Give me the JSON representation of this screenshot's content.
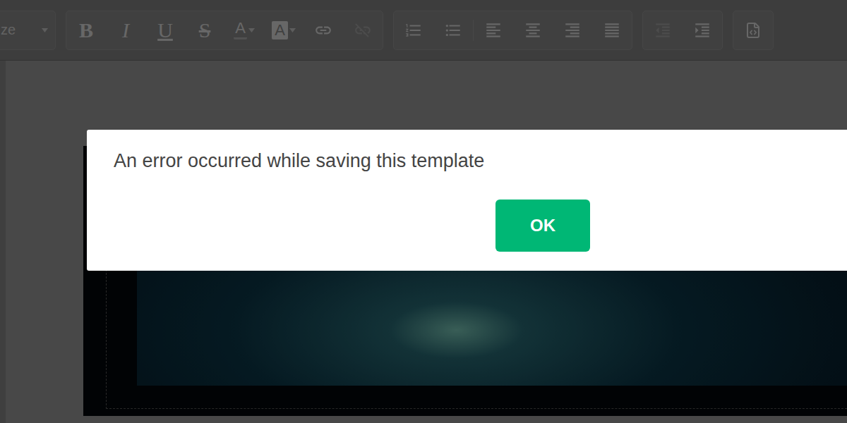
{
  "toolbar": {
    "font_size": "ze",
    "format_buttons": [
      {
        "label": "B",
        "kind": "bold"
      },
      {
        "label": "I",
        "kind": "italic"
      },
      {
        "label": "U",
        "kind": "underline"
      },
      {
        "label": "S",
        "kind": "strike"
      }
    ],
    "color_buttons": [
      {
        "label": "A",
        "kind": "text-color"
      },
      {
        "label": "A",
        "kind": "highlight"
      }
    ],
    "link_disabled": false,
    "unlink_disabled": true,
    "outdent_disabled": true,
    "indent_disabled": false
  },
  "dialog": {
    "message": "An error occurred while saving this template",
    "buttons": [
      "OK"
    ]
  }
}
